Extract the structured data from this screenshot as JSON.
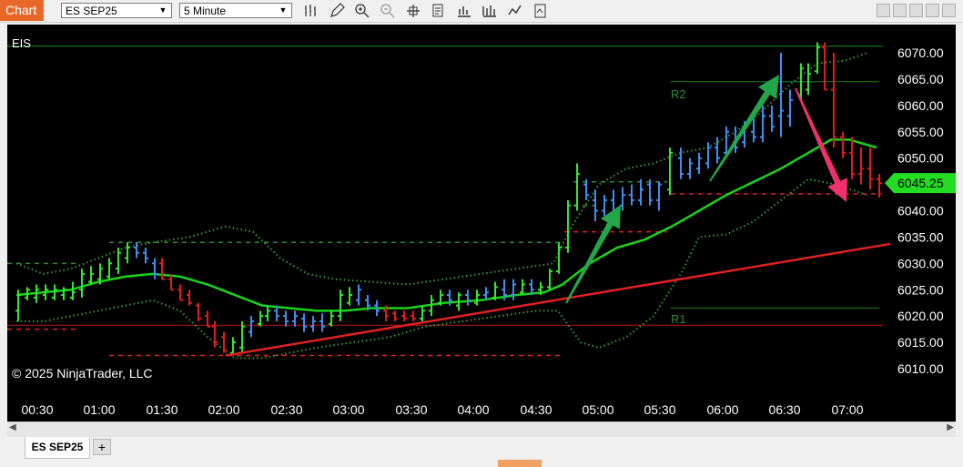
{
  "toolbar": {
    "chart_label": "Chart",
    "instrument_value": "ES SEP25",
    "interval_value": "5 Minute",
    "icons": [
      "bar-type-icon",
      "draw-pencil-icon",
      "zoom-in-icon",
      "zoom-out-icon",
      "crosshair-icon",
      "data-box-icon",
      "indicators-icon",
      "strategies-icon",
      "templates-icon",
      "properties-icon"
    ]
  },
  "chart": {
    "symbol_label": "EIS",
    "copyright": "© 2025 NinjaTrader, LLC",
    "current_price": "6045.25",
    "pivot_labels": {
      "r2": "R2",
      "r1": "R1"
    },
    "colors": {
      "up": "#33e633",
      "down": "#e21b1b",
      "neutral": "#3e8ef0",
      "ma": "#19d419",
      "band": "#3a9a3a",
      "trend": "#e02020",
      "price_tag": "#22dd22",
      "arrow_up": "#22a64a",
      "arrow_down": "#f0306a"
    },
    "chart_data": {
      "type": "candlestick",
      "y_ticks": [
        "6070.00",
        "6065.00",
        "6060.00",
        "6055.00",
        "6050.00",
        "6045.00",
        "6040.00",
        "6035.00",
        "6030.00",
        "6025.00",
        "6020.00",
        "6015.00",
        "6010.00"
      ],
      "x_ticks": [
        "00:30",
        "01:00",
        "01:30",
        "02:00",
        "02:30",
        "03:00",
        "03:30",
        "04:00",
        "04:30",
        "05:00",
        "05:30",
        "06:00",
        "06:30",
        "07:00"
      ],
      "ylim": [
        6006,
        6073
      ],
      "levels": {
        "r2": 6064.5,
        "r1": 6021.5,
        "top_line": 6071.25,
        "bottom_line": 6018.25
      }
    }
  },
  "tabs": {
    "active": "ES SEP25",
    "add_label": "+"
  }
}
